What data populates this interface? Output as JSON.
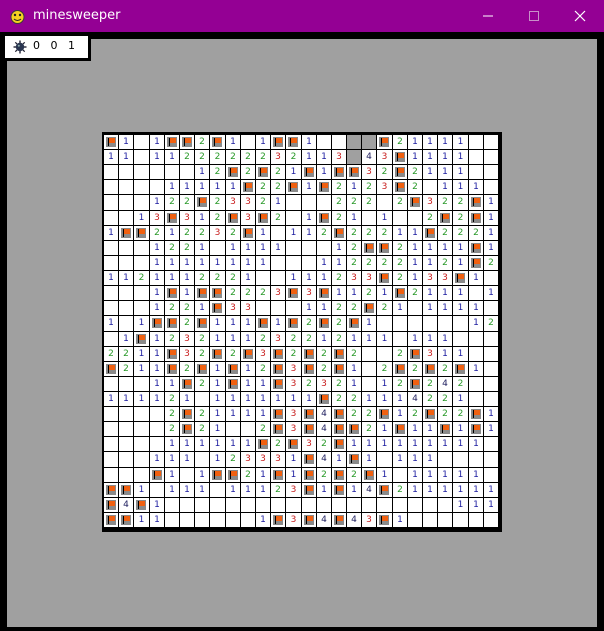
{
  "window": {
    "title": "minesweeper",
    "colors": {
      "titlebar": "#940094",
      "frame": "#000000",
      "background": "#a0a0a0"
    }
  },
  "counter": {
    "icon": "mine-icon",
    "digits": [
      "0",
      "0",
      "1"
    ],
    "display": "0   0   1"
  },
  "number_colors": {
    "1": "#1c1ca0",
    "2": "#2a9a2a",
    "3": "#c81e1e",
    "4": "#202060",
    "5": "#7a1a1a"
  },
  "board": {
    "cols": 26,
    "rows": 26,
    "legend": {
      ".": "revealed-empty",
      "F": "flagged",
      "#": "covered",
      "1-8": "adjacent-mine-count"
    },
    "grid": [
      "F1.1FF2F1.1FF1..##F21111..",
      "11.1122222232113#43F1111..",
      "......12F2F21F1FF32F2111..",
      "....11111F22F1F2123F2.111.",
      "...122F23321...222.2F322F1",
      "..13F312F3F2.1F21.1..2F2F1",
      "1FF212232F1.112F22211F2221",
      "...1221.1111...12FF21111F1",
      "...11111111...1122221121F2",
      "1121112221..111233F2133F1.",
      "...1F1FF2223F3F1121F2111.1",
      "...1221F33...1122F21.1111.",
      "1.1FF2F111F1F2F2F1......12",
      ".1F1232111232212111.111...",
      "2211F32F2F3F2F2F2..2F311..",
      "F211F2F1F12F3F2F1.2F2F2F1.",
      "...11F21F11F32321.12F242...",
      "111121.1111111F221114221...",
      "....2F21111F3F4F22F12F22F1",
      "....2F21..2F3F4FF21F11F1F1",
      "....111111F2F32F111111111.",
      "...111.123331F41F1.111....",
      "...F1.1FF21F1F2F2F1.11111.",
      "FF1.111.11123F1F14F2111111",
      "F4F1...................111",
      "FF11......1F3F4F43F1......"
    ]
  }
}
